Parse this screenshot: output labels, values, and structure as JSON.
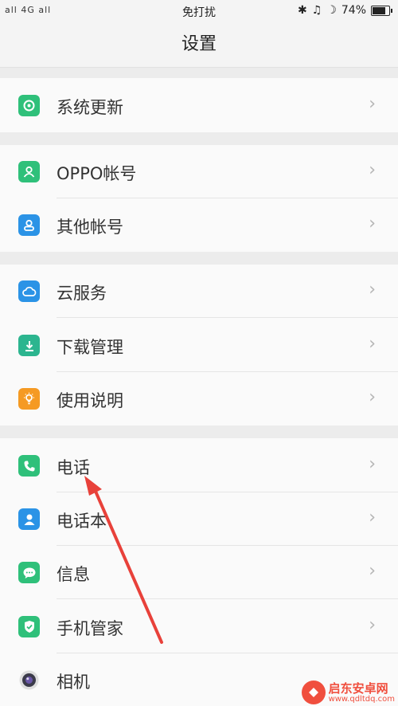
{
  "status_bar": {
    "signal_text": "all 4G all",
    "center_text": "免打扰",
    "battery_text": "74%",
    "battery_level": 0.74
  },
  "title": "设置",
  "rows": [
    {
      "label": "系统更新",
      "icon": "system-update-icon",
      "color": "#2fc07a"
    },
    {
      "label": "OPPO帐号",
      "icon": "oppo-account-icon",
      "color": "#2fc07a"
    },
    {
      "label": "其他帐号",
      "icon": "other-accounts-icon",
      "color": "#2b93e6"
    },
    {
      "label": "云服务",
      "icon": "cloud-service-icon",
      "color": "#2b93e6"
    },
    {
      "label": "下载管理",
      "icon": "download-manager-icon",
      "color": "#2cb58f"
    },
    {
      "label": "使用说明",
      "icon": "user-guide-icon",
      "color": "#f59a23"
    },
    {
      "label": "电话",
      "icon": "phone-icon",
      "color": "#2fc07a"
    },
    {
      "label": "电话本",
      "icon": "contacts-icon",
      "color": "#2b93e6"
    },
    {
      "label": "信息",
      "icon": "messages-icon",
      "color": "#2fc07a"
    },
    {
      "label": "手机管家",
      "icon": "phone-manager-icon",
      "color": "#2fc07a"
    },
    {
      "label": "相机",
      "icon": "camera-icon",
      "color": "#555555"
    }
  ],
  "chevron": "›",
  "watermark": {
    "name": "启东安卓网",
    "url": "www.qdltdq.com"
  }
}
